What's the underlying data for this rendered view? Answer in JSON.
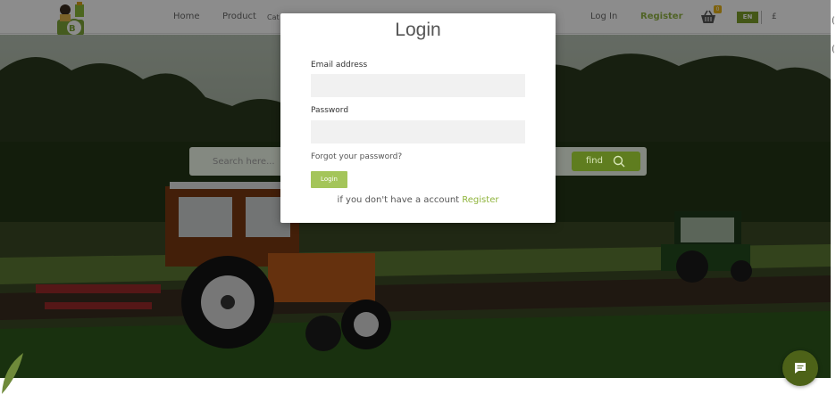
{
  "header": {
    "nav": {
      "home": "Home",
      "product": "Product",
      "cat": "Cat",
      "login": "Log In",
      "register": "Register"
    },
    "cart_count": "0",
    "language": "EN",
    "currency": "£",
    "colors": {
      "accent": "#93b545",
      "lang_bg": "#7c9f2b"
    }
  },
  "hero": {
    "search_placeholder": "Search here...",
    "find_label": "find"
  },
  "modal": {
    "title": "Login",
    "email_label": "Email address",
    "password_label": "Password",
    "forgot_label": "Forgot your password?",
    "login_button": "Login",
    "signup_prompt": "if you don't have a account",
    "signup_link": "Register"
  },
  "edge_glyphs": [
    "(",
    "("
  ]
}
